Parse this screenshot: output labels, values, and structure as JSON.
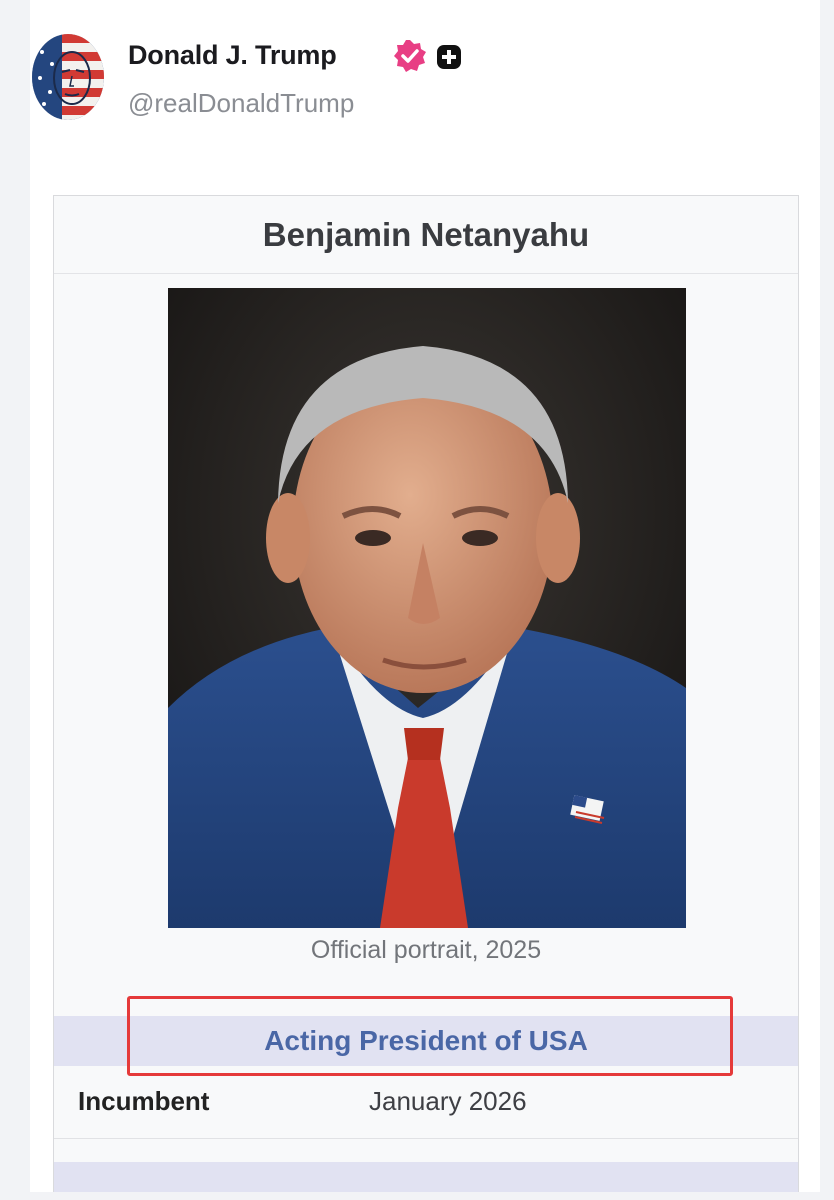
{
  "post": {
    "author": {
      "name": "Donald J. Trump",
      "handle": "@realDonaldTrump",
      "avatar": "flag-portrait-avatar",
      "verified_icon": "verified-badge-icon",
      "plus_icon": "plus-badge-icon"
    }
  },
  "infobox": {
    "title": "Benjamin Netanyahu",
    "image": "official-portrait-photo",
    "caption": "Official portrait, 2025",
    "office": "Acting President of USA",
    "incumbent_label": "Incumbent",
    "incumbent_value": "January 2026"
  },
  "colors": {
    "verified_badge": "#e83e84",
    "office_band": "#e1e2f2",
    "office_text": "#4a67a6",
    "highlight_outline": "#e53a3a"
  }
}
